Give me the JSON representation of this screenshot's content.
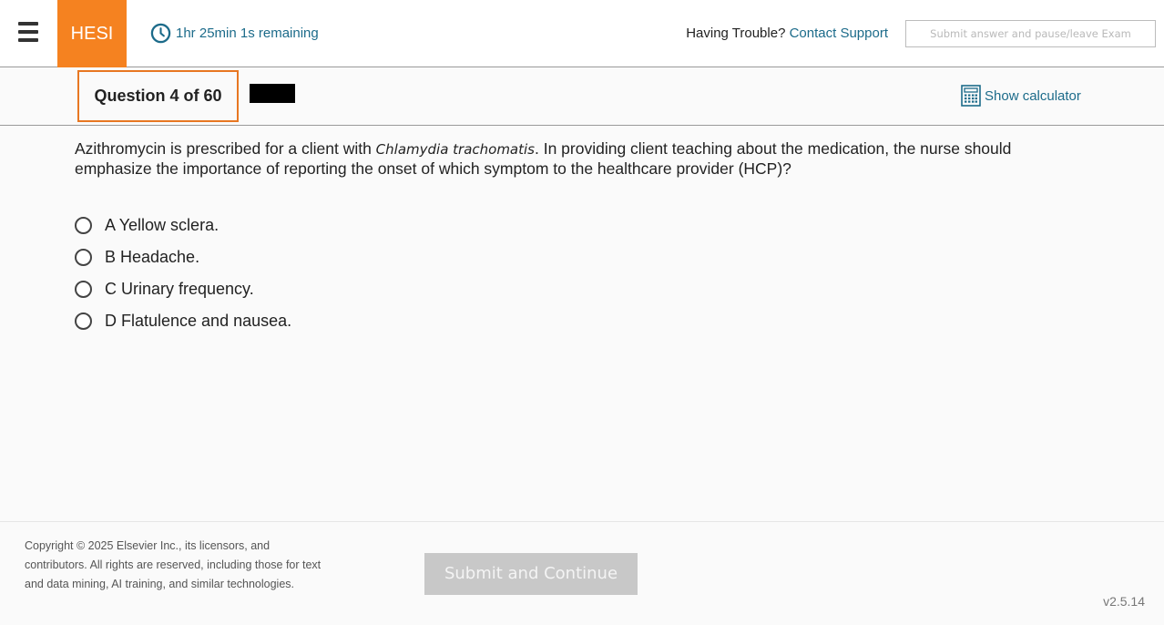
{
  "header": {
    "logo": "HESI",
    "timer": "1hr 25min 1s remaining",
    "trouble_label": "Having Trouble?",
    "contact_label": "Contact Support",
    "pause_button": "Submit answer and pause/leave Exam"
  },
  "subheader": {
    "question_counter": "Question 4 of 60",
    "calculator_label": "Show calculator"
  },
  "question": {
    "text_before": "Azithromycin is prescribed for a client with ",
    "text_italic": "Chlamydia trachomatis",
    "text_after": ". In providing client teaching about the medication, the nurse should emphasize the importance of reporting the onset of which symptom to the healthcare provider (HCP)?",
    "options": [
      {
        "label": "A Yellow sclera."
      },
      {
        "label": "B Headache."
      },
      {
        "label": "C Urinary frequency."
      },
      {
        "label": "D Flatulence and nausea."
      }
    ]
  },
  "footer": {
    "copyright": "Copyright © 2025 Elsevier Inc., its licensors, and contributors. All rights are reserved, including those for text and data mining, AI training, and similar technologies.",
    "submit_button": "Submit and Continue",
    "version": "v2.5.14"
  },
  "colors": {
    "brand_orange": "#f58220",
    "link_teal": "#1c6b8a",
    "disabled_gray": "#c8c8c8"
  },
  "icons": [
    "hamburger-menu-icon",
    "clock-icon",
    "calculator-icon",
    "radio-icon"
  ]
}
